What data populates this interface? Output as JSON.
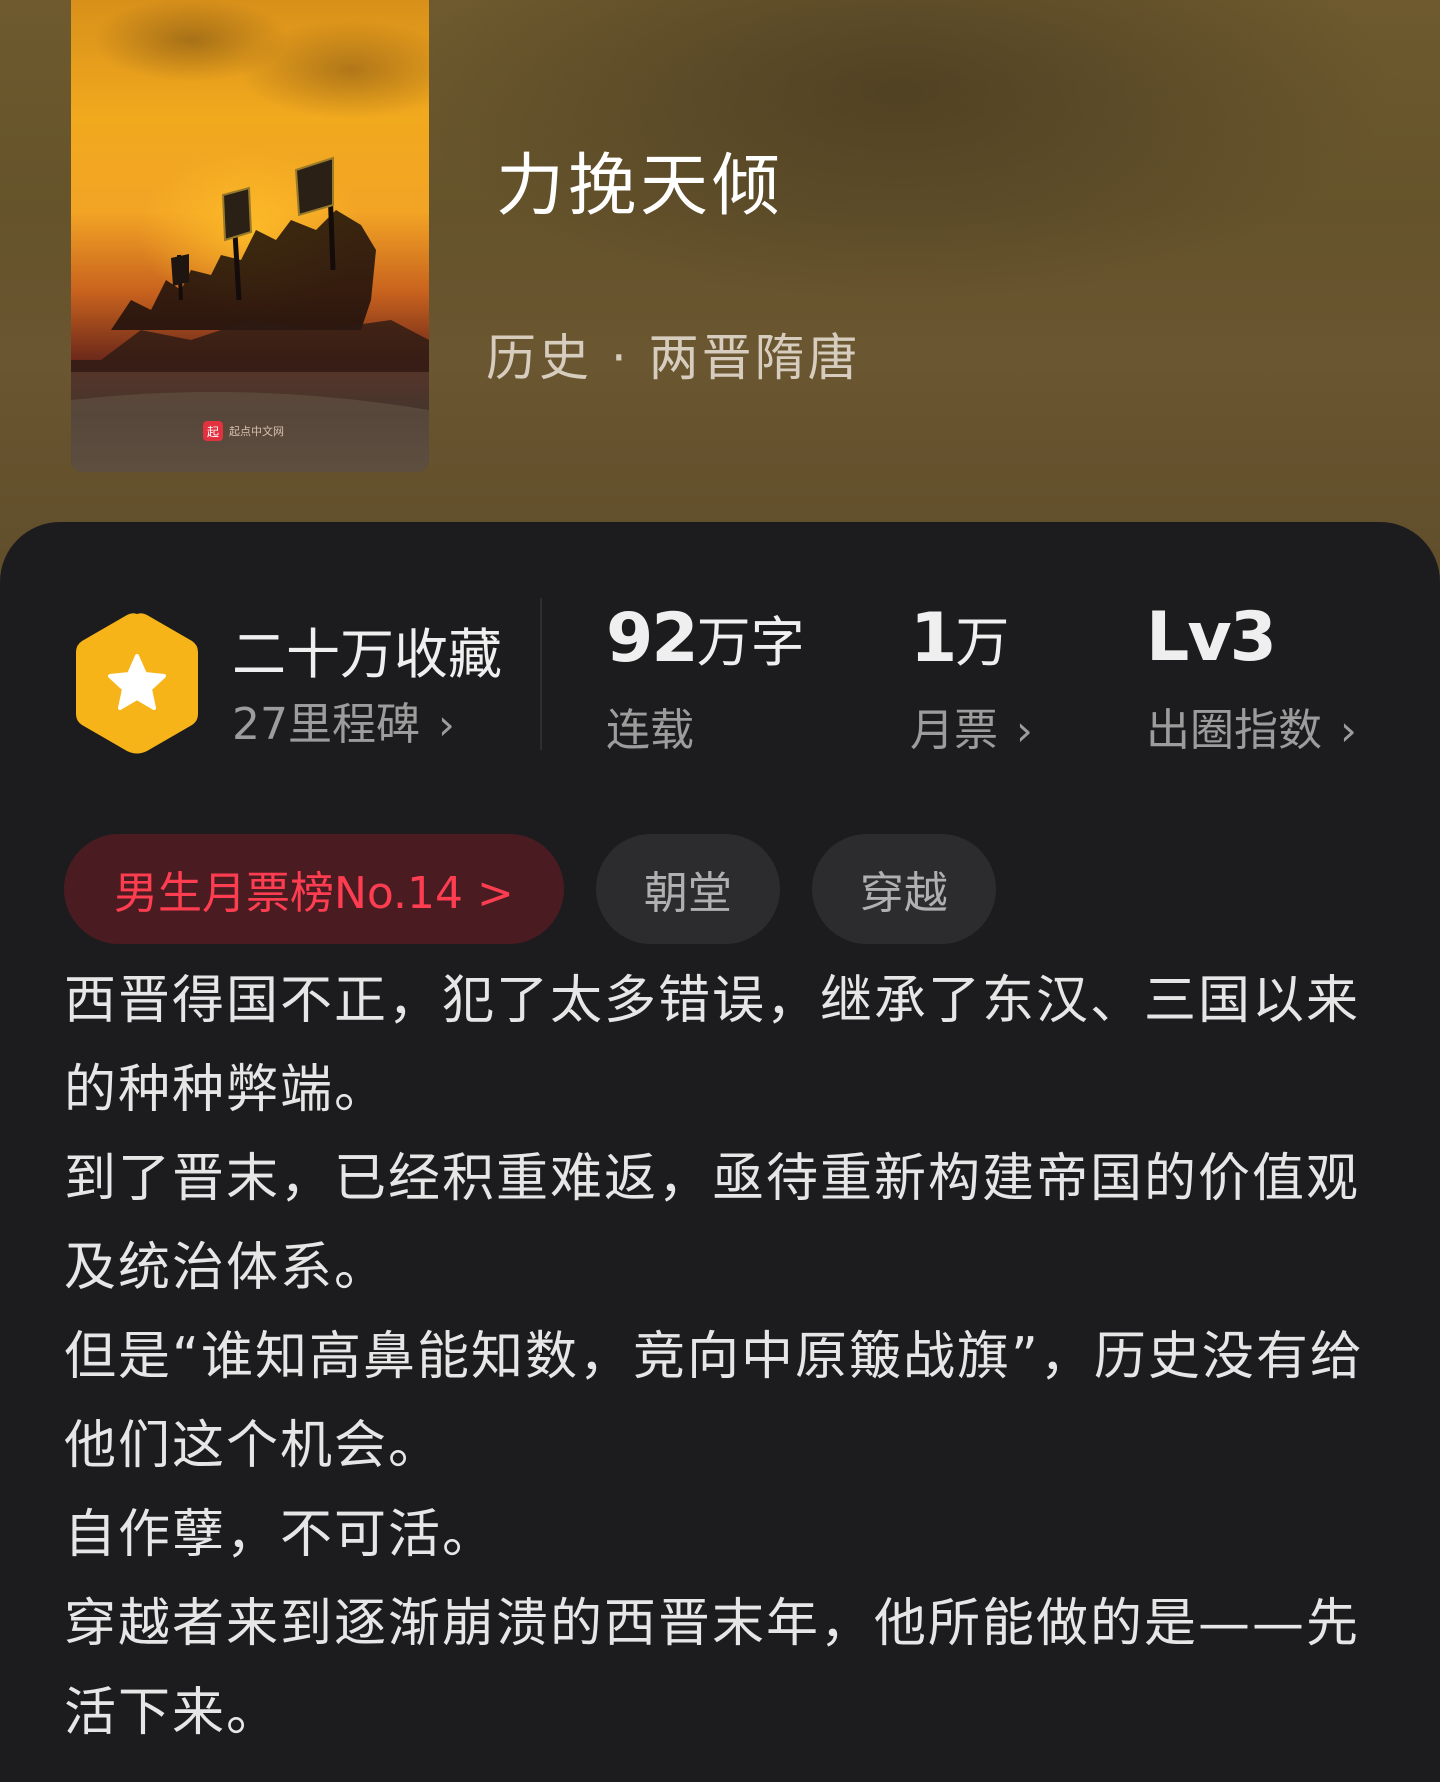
{
  "book": {
    "title": "力挽天倾",
    "genre": "历史 · 两晋隋唐",
    "cover_watermark": "起点中文网"
  },
  "stats": {
    "collection": {
      "title": "二十万收藏",
      "subtitle": "27里程碑",
      "icon": "star-hexagon-icon"
    },
    "words": {
      "number": "92",
      "unit": "万字",
      "label": "连载"
    },
    "monthly_ticket": {
      "number": "1",
      "unit": "万",
      "label": "月票"
    },
    "circle_index": {
      "value": "Lv3",
      "label": "出圈指数"
    }
  },
  "tags": {
    "rank": "男生月票榜No.14 >",
    "items": [
      "朝堂",
      "穿越"
    ]
  },
  "description": [
    "西晋得国不正，犯了太多错误，继承了东汉、三国以来的种种弊端。",
    "到了晋末，已经积重难返，亟待重新构建帝国的价值观及统治体系。",
    "但是“谁知高鼻能知数，竞向中原簸战旗”，历史没有给他们这个机会。",
    "自作孽，不可活。",
    "穿越者来到逐渐崩溃的西晋末年，他所能做的是——先活下来。"
  ],
  "colors": {
    "header_bg": "#6a5630",
    "card_bg": "#1c1c1e",
    "rank_tag_text": "#ff3d50",
    "rank_tag_bg": "#4a1c22",
    "tag_bg": "#2c2c2e",
    "hex_badge": "#f7b419"
  }
}
